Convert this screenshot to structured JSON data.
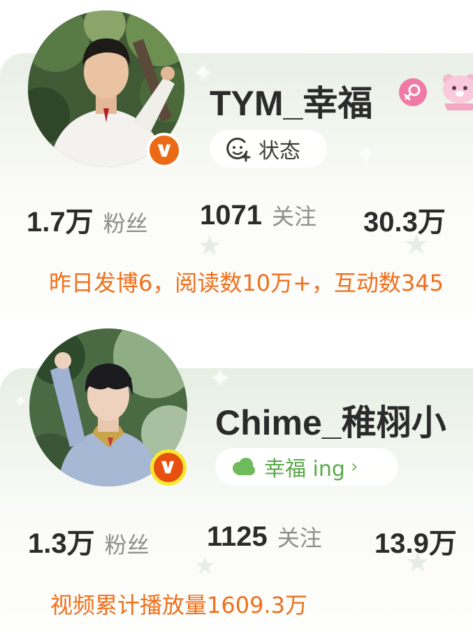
{
  "colors": {
    "accent_orange": "#f06f1a",
    "name_text": "#2b2b2b",
    "stat_label": "#8e8e8e",
    "green_status": "#5aa84a",
    "gender_pink": "#f07aa6",
    "vip_orange": "#ea6a16"
  },
  "profiles": [
    {
      "name": "TYM_幸福",
      "avatar_icon": "profile-photo",
      "badge_icon": "verified-v-icon",
      "gender_icon": "female-icon",
      "decoration_icon": "pink-bear-sticker",
      "status": {
        "icon": "smile-add-icon",
        "label": "状态",
        "chevron": ""
      },
      "stats": [
        {
          "value": "1.7万",
          "label": "粉丝"
        },
        {
          "value": "1071",
          "label": "关注"
        },
        {
          "value": "30.3万",
          "label": ""
        }
      ],
      "info": "昨日发博6，阅读数10万+，互动数345"
    },
    {
      "name": "Chime_稚栩小",
      "avatar_icon": "profile-photo",
      "badge_icon": "verified-v-icon",
      "status": {
        "icon": "cloud-icon",
        "label": "幸福 ing",
        "chevron": "›"
      },
      "stats": [
        {
          "value": "1.3万",
          "label": "粉丝"
        },
        {
          "value": "1125",
          "label": "关注"
        },
        {
          "value": "13.9万",
          "label": ""
        }
      ],
      "info": "视频累计播放量1609.3万"
    }
  ]
}
